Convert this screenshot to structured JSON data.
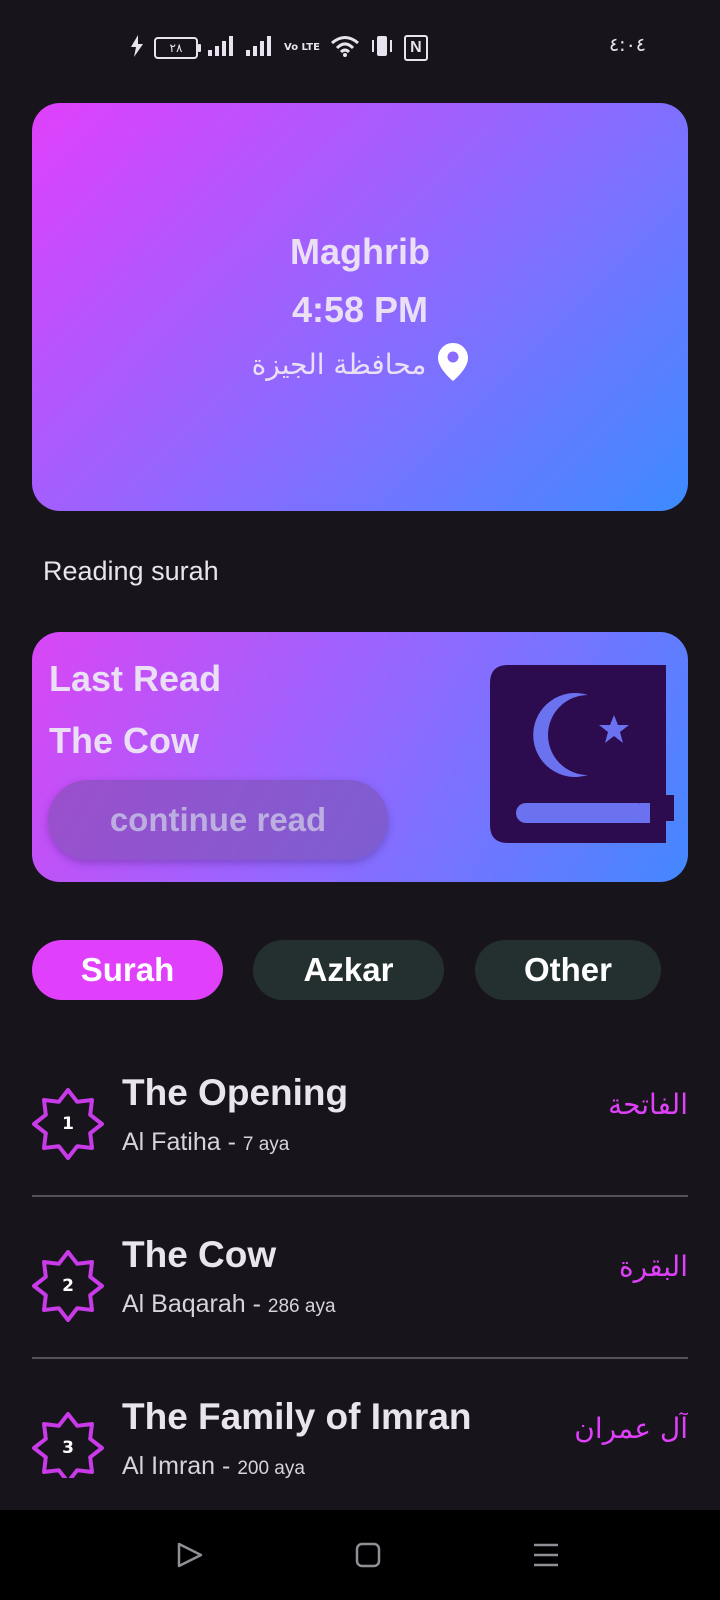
{
  "status_bar": {
    "battery_level": "٢٨",
    "volte_label": "Vo LTE",
    "nfc_label": "N",
    "time": "٤:٠٤"
  },
  "prayer_card": {
    "prayer_name": "Maghrib",
    "prayer_time": "4:58 PM",
    "location": "محافظة الجيزة",
    "location_icon": "location-pin-icon"
  },
  "section_title": "Reading surah",
  "last_read": {
    "label": "Last Read",
    "surah_name": "The Cow",
    "button_label": "continue read",
    "icon": "quran-book-icon"
  },
  "tabs": [
    {
      "label": "Surah",
      "active": true
    },
    {
      "label": "Azkar",
      "active": false
    },
    {
      "label": "Other",
      "active": false
    }
  ],
  "surahs": [
    {
      "number": "1",
      "english_name": "The Opening",
      "transliteration": "Al Fatiha",
      "separator": " - ",
      "aya_count": "7 aya",
      "arabic_name": "الفاتحة"
    },
    {
      "number": "2",
      "english_name": "The Cow",
      "transliteration": "Al Baqarah",
      "separator": " - ",
      "aya_count": "286 aya",
      "arabic_name": "البقرة"
    },
    {
      "number": "3",
      "english_name": "The Family of Imran",
      "transliteration": "Al Imran",
      "separator": " - ",
      "aya_count": "200 aya",
      "arabic_name": "آل عمران"
    }
  ],
  "colors": {
    "background": "#17151b",
    "accent": "#e040fb",
    "tab_inactive": "#243030",
    "gradient_start": "#e040fb",
    "gradient_end": "#3d8bff"
  },
  "nav_bar": {
    "back_icon": "triangle-back-icon",
    "home_icon": "square-home-icon",
    "menu_icon": "menu-lines-icon"
  }
}
